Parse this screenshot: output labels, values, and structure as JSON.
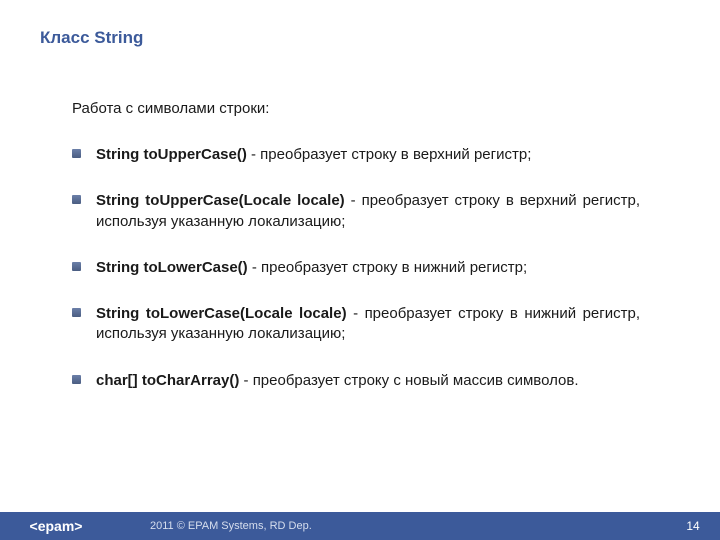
{
  "title": "Класс String",
  "intro": "Работа с символами строки:",
  "items": [
    {
      "sig": "String toUpperCase()",
      "desc": " - преобразует строку в верхний регистр;"
    },
    {
      "sig": "String toUpperCase(Locale locale)",
      "desc": " - преобразует строку в верхний регистр, используя указанную локализацию;"
    },
    {
      "sig": "String toLowerCase()",
      "desc": " - преобразует строку в нижний регистр;"
    },
    {
      "sig": "String toLowerCase(Locale locale)",
      "desc": " - преобразует строку в нижний регистр, используя указанную локализацию;"
    },
    {
      "sig": " char[]    toCharArray()",
      "desc": " - преобразует строку с новый массив символов."
    }
  ],
  "footer": {
    "logo": "<epam>",
    "copyright": "2011 © EPAM Systems, RD Dep.",
    "page": "14"
  }
}
